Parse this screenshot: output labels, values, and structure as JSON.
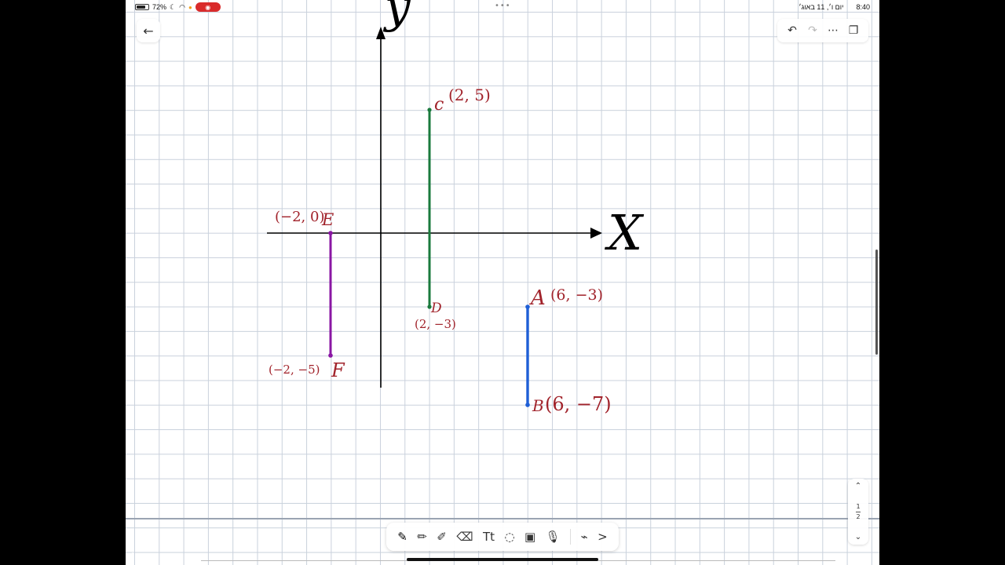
{
  "status": {
    "battery": "72%",
    "time": "8:40",
    "date": "יום ו׳, 11 באוג׳"
  },
  "nav": {
    "back_icon": "←",
    "undo_icon": "↶",
    "redo_icon": "↷",
    "more_icon": "⋯",
    "pages_icon": "❐"
  },
  "page": {
    "current": "1",
    "total": "2"
  },
  "axes": {
    "x_label": "X",
    "y_label": "y"
  },
  "colors": {
    "segment_CD": "#1a7a3c",
    "segment_EF": "#8a16a3",
    "segment_AB": "#1f5fd6",
    "label": "#a1232b",
    "record": "#d92b2b"
  },
  "points": [
    {
      "name": "c",
      "coord": "(2, 5)",
      "x": 2,
      "y": 5
    },
    {
      "name": "D",
      "coord": "(2, −3)",
      "x": 2,
      "y": -3
    },
    {
      "name": "E",
      "coord": "(−2, 0)",
      "x": -2,
      "y": 0
    },
    {
      "name": "F",
      "coord": "(−2, −5)",
      "x": -2,
      "y": -5
    },
    {
      "name": "A",
      "coord": "(6, −3)",
      "x": 6,
      "y": -3
    },
    {
      "name": "B",
      "coord": "(6, −7)",
      "x": 6,
      "y": -7
    }
  ],
  "toolbar": [
    "pen",
    "pencil",
    "highlighter",
    "eraser",
    "Tt",
    "lasso",
    "image",
    "mic",
    "link",
    ">"
  ]
}
